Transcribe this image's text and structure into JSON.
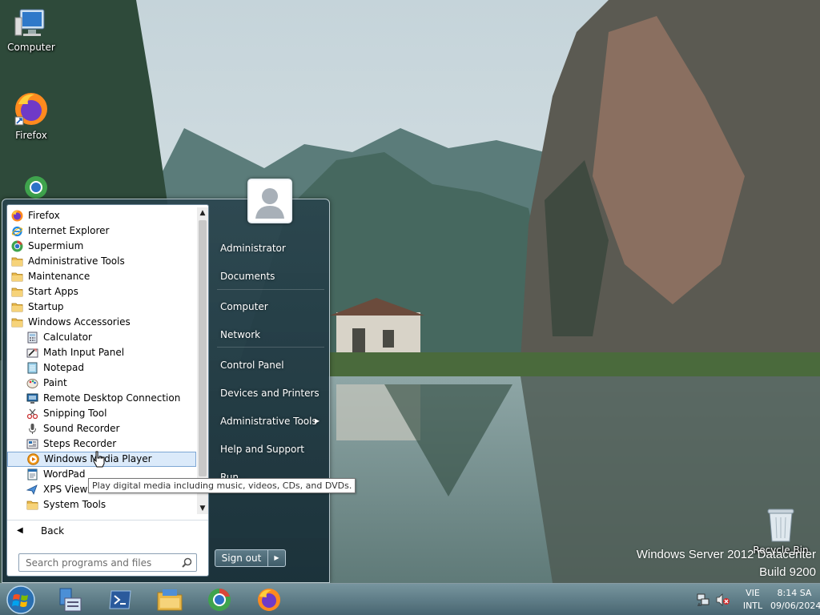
{
  "desktop": {
    "icons": [
      {
        "label": "Computer",
        "icon": "computer-icon"
      },
      {
        "label": "Firefox",
        "icon": "firefox-icon"
      },
      {
        "label": "Recycle Bin",
        "icon": "recycle-bin-icon"
      }
    ],
    "watermark": {
      "edition": "Windows Server 2012 Datacenter",
      "build": "Build 9200"
    }
  },
  "start_menu": {
    "programs": [
      {
        "label": "Firefox",
        "icon": "firefox-icon"
      },
      {
        "label": "Internet Explorer",
        "icon": "internet-explorer-icon"
      },
      {
        "label": "Supermium",
        "icon": "supermium-icon"
      },
      {
        "label": "Administrative Tools",
        "icon": "folder-icon"
      },
      {
        "label": "Maintenance",
        "icon": "folder-icon"
      },
      {
        "label": "Start Apps",
        "icon": "folder-icon"
      },
      {
        "label": "Startup",
        "icon": "folder-icon"
      },
      {
        "label": "Windows Accessories",
        "icon": "folder-icon"
      },
      {
        "label": "Calculator",
        "icon": "calculator-icon"
      },
      {
        "label": "Math Input Panel",
        "icon": "math-input-icon"
      },
      {
        "label": "Notepad",
        "icon": "notepad-icon"
      },
      {
        "label": "Paint",
        "icon": "paint-icon"
      },
      {
        "label": "Remote Desktop Connection",
        "icon": "remote-desktop-icon"
      },
      {
        "label": "Snipping Tool",
        "icon": "snipping-tool-icon"
      },
      {
        "label": "Sound Recorder",
        "icon": "microphone-icon"
      },
      {
        "label": "Steps Recorder",
        "icon": "steps-recorder-icon"
      },
      {
        "label": "Windows Media Player",
        "icon": "media-player-icon"
      },
      {
        "label": "WordPad",
        "icon": "wordpad-icon"
      },
      {
        "label": "XPS Viewer",
        "icon": "xps-viewer-icon"
      },
      {
        "label": "System Tools",
        "icon": "folder-icon"
      }
    ],
    "selected_program": "Windows Media Player",
    "back_label": "Back",
    "search_placeholder": "Search programs and files",
    "right_items": [
      {
        "label": "Administrator"
      },
      {
        "label": "Documents"
      },
      {
        "label": "Computer"
      },
      {
        "label": "Network"
      },
      {
        "label": "Control Panel"
      },
      {
        "label": "Devices and Printers"
      },
      {
        "label": "Administrative Tools",
        "has_submenu": true
      },
      {
        "label": "Help and Support"
      },
      {
        "label": "Run..."
      }
    ],
    "sign_out_label": "Sign out",
    "tooltip": "Play digital media including music, videos, CDs, and DVDs."
  },
  "taskbar": {
    "pinned": [
      {
        "name": "server-manager",
        "icon": "server-manager-icon"
      },
      {
        "name": "powershell",
        "icon": "powershell-icon"
      },
      {
        "name": "file-explorer",
        "icon": "file-explorer-icon"
      },
      {
        "name": "supermium",
        "icon": "supermium-icon"
      },
      {
        "name": "firefox",
        "icon": "firefox-icon"
      }
    ],
    "tray": {
      "language": "VIE",
      "keyboard": "INTL",
      "time": "8:14 SA",
      "date": "09/06/2024",
      "volume": "muted"
    }
  },
  "colors": {
    "selection_bg": "#dbeafa",
    "selection_border": "#7ea7d4",
    "menu_glass": "#28424c"
  }
}
